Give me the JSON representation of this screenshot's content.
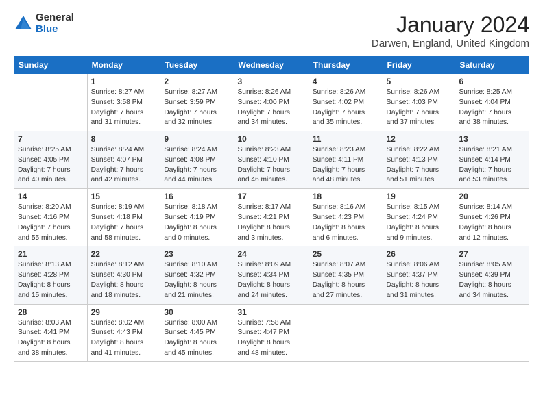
{
  "header": {
    "logo": {
      "general": "General",
      "blue": "Blue"
    },
    "title": "January 2024",
    "location": "Darwen, England, United Kingdom"
  },
  "weekdays": [
    "Sunday",
    "Monday",
    "Tuesday",
    "Wednesday",
    "Thursday",
    "Friday",
    "Saturday"
  ],
  "weeks": [
    [
      {
        "day": "",
        "info": ""
      },
      {
        "day": "1",
        "info": "Sunrise: 8:27 AM\nSunset: 3:58 PM\nDaylight: 7 hours\nand 31 minutes."
      },
      {
        "day": "2",
        "info": "Sunrise: 8:27 AM\nSunset: 3:59 PM\nDaylight: 7 hours\nand 32 minutes."
      },
      {
        "day": "3",
        "info": "Sunrise: 8:26 AM\nSunset: 4:00 PM\nDaylight: 7 hours\nand 34 minutes."
      },
      {
        "day": "4",
        "info": "Sunrise: 8:26 AM\nSunset: 4:02 PM\nDaylight: 7 hours\nand 35 minutes."
      },
      {
        "day": "5",
        "info": "Sunrise: 8:26 AM\nSunset: 4:03 PM\nDaylight: 7 hours\nand 37 minutes."
      },
      {
        "day": "6",
        "info": "Sunrise: 8:25 AM\nSunset: 4:04 PM\nDaylight: 7 hours\nand 38 minutes."
      }
    ],
    [
      {
        "day": "7",
        "info": "Sunrise: 8:25 AM\nSunset: 4:05 PM\nDaylight: 7 hours\nand 40 minutes."
      },
      {
        "day": "8",
        "info": "Sunrise: 8:24 AM\nSunset: 4:07 PM\nDaylight: 7 hours\nand 42 minutes."
      },
      {
        "day": "9",
        "info": "Sunrise: 8:24 AM\nSunset: 4:08 PM\nDaylight: 7 hours\nand 44 minutes."
      },
      {
        "day": "10",
        "info": "Sunrise: 8:23 AM\nSunset: 4:10 PM\nDaylight: 7 hours\nand 46 minutes."
      },
      {
        "day": "11",
        "info": "Sunrise: 8:23 AM\nSunset: 4:11 PM\nDaylight: 7 hours\nand 48 minutes."
      },
      {
        "day": "12",
        "info": "Sunrise: 8:22 AM\nSunset: 4:13 PM\nDaylight: 7 hours\nand 51 minutes."
      },
      {
        "day": "13",
        "info": "Sunrise: 8:21 AM\nSunset: 4:14 PM\nDaylight: 7 hours\nand 53 minutes."
      }
    ],
    [
      {
        "day": "14",
        "info": "Sunrise: 8:20 AM\nSunset: 4:16 PM\nDaylight: 7 hours\nand 55 minutes."
      },
      {
        "day": "15",
        "info": "Sunrise: 8:19 AM\nSunset: 4:18 PM\nDaylight: 7 hours\nand 58 minutes."
      },
      {
        "day": "16",
        "info": "Sunrise: 8:18 AM\nSunset: 4:19 PM\nDaylight: 8 hours\nand 0 minutes."
      },
      {
        "day": "17",
        "info": "Sunrise: 8:17 AM\nSunset: 4:21 PM\nDaylight: 8 hours\nand 3 minutes."
      },
      {
        "day": "18",
        "info": "Sunrise: 8:16 AM\nSunset: 4:23 PM\nDaylight: 8 hours\nand 6 minutes."
      },
      {
        "day": "19",
        "info": "Sunrise: 8:15 AM\nSunset: 4:24 PM\nDaylight: 8 hours\nand 9 minutes."
      },
      {
        "day": "20",
        "info": "Sunrise: 8:14 AM\nSunset: 4:26 PM\nDaylight: 8 hours\nand 12 minutes."
      }
    ],
    [
      {
        "day": "21",
        "info": "Sunrise: 8:13 AM\nSunset: 4:28 PM\nDaylight: 8 hours\nand 15 minutes."
      },
      {
        "day": "22",
        "info": "Sunrise: 8:12 AM\nSunset: 4:30 PM\nDaylight: 8 hours\nand 18 minutes."
      },
      {
        "day": "23",
        "info": "Sunrise: 8:10 AM\nSunset: 4:32 PM\nDaylight: 8 hours\nand 21 minutes."
      },
      {
        "day": "24",
        "info": "Sunrise: 8:09 AM\nSunset: 4:34 PM\nDaylight: 8 hours\nand 24 minutes."
      },
      {
        "day": "25",
        "info": "Sunrise: 8:07 AM\nSunset: 4:35 PM\nDaylight: 8 hours\nand 27 minutes."
      },
      {
        "day": "26",
        "info": "Sunrise: 8:06 AM\nSunset: 4:37 PM\nDaylight: 8 hours\nand 31 minutes."
      },
      {
        "day": "27",
        "info": "Sunrise: 8:05 AM\nSunset: 4:39 PM\nDaylight: 8 hours\nand 34 minutes."
      }
    ],
    [
      {
        "day": "28",
        "info": "Sunrise: 8:03 AM\nSunset: 4:41 PM\nDaylight: 8 hours\nand 38 minutes."
      },
      {
        "day": "29",
        "info": "Sunrise: 8:02 AM\nSunset: 4:43 PM\nDaylight: 8 hours\nand 41 minutes."
      },
      {
        "day": "30",
        "info": "Sunrise: 8:00 AM\nSunset: 4:45 PM\nDaylight: 8 hours\nand 45 minutes."
      },
      {
        "day": "31",
        "info": "Sunrise: 7:58 AM\nSunset: 4:47 PM\nDaylight: 8 hours\nand 48 minutes."
      },
      {
        "day": "",
        "info": ""
      },
      {
        "day": "",
        "info": ""
      },
      {
        "day": "",
        "info": ""
      }
    ]
  ]
}
